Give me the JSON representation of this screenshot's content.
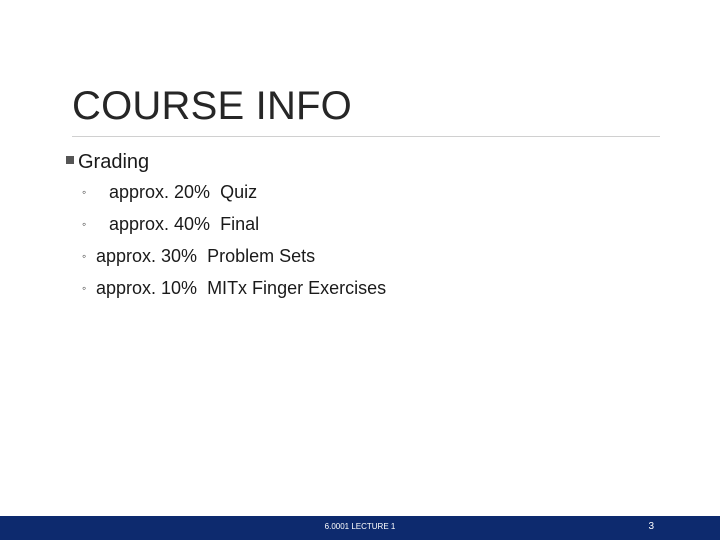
{
  "slide": {
    "title": "COURSE INFO",
    "level1": {
      "text": "Grading"
    },
    "items": [
      {
        "text": " approx. 20%  Quiz"
      },
      {
        "text": " approx. 40%  Final"
      },
      {
        "text": "approx. 30%  Problem Sets"
      },
      {
        "text": "approx. 10%  MITx Finger Exercises"
      }
    ],
    "sub_bullet_glyph": "◦"
  },
  "footer": {
    "label": "6.0001 LECTURE 1",
    "page_number": "3",
    "background_color": "#0d2a6e"
  }
}
